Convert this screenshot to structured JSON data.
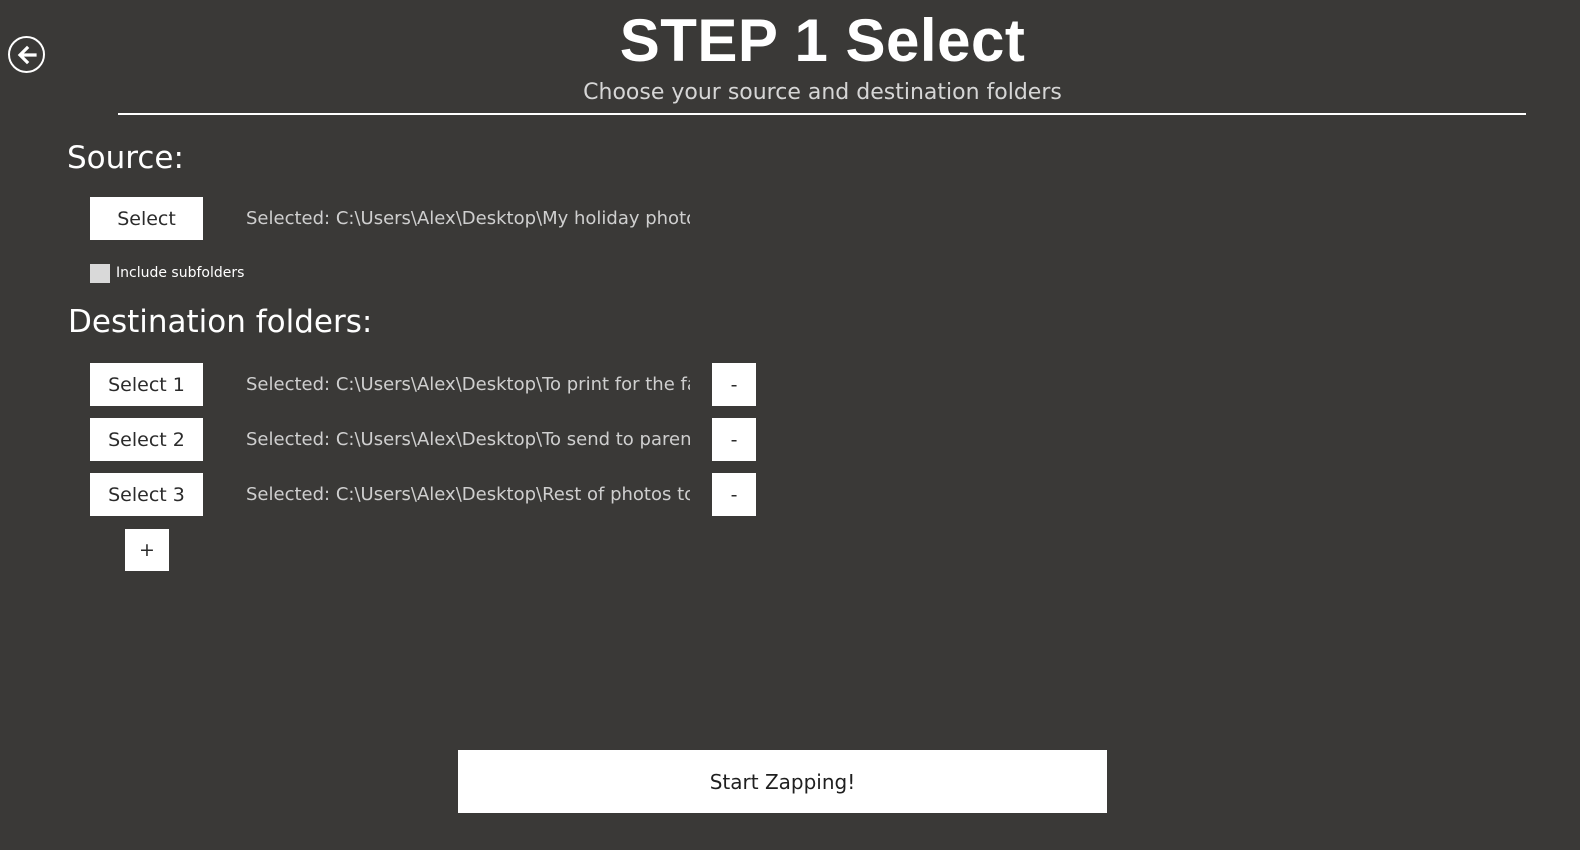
{
  "header": {
    "title": "STEP 1 Select",
    "subtitle": "Choose your source and destination folders"
  },
  "source": {
    "heading": "Source:",
    "select_label": "Select",
    "selected_text": "Selected: C:\\Users\\Alex\\Desktop\\My holiday photos",
    "include_subfolders_label": "Include subfolders",
    "include_subfolders_checked": false
  },
  "destinations": {
    "heading": "Destination folders:",
    "items": [
      {
        "select_label": "Select 1",
        "selected_text": "Selected: C:\\Users\\Alex\\Desktop\\To print for the family",
        "remove_label": "-"
      },
      {
        "select_label": "Select 2",
        "selected_text": "Selected: C:\\Users\\Alex\\Desktop\\To send to parents",
        "remove_label": "-"
      },
      {
        "select_label": "Select 3",
        "selected_text": "Selected: C:\\Users\\Alex\\Desktop\\Rest of photos to keep",
        "remove_label": "-"
      }
    ],
    "add_label": "+"
  },
  "start_label": "Start Zapping!",
  "colors": {
    "background": "#3a3937",
    "button_bg": "#ffffff",
    "button_text": "#2b2b2b",
    "secondary_text": "#cfcfcf"
  },
  "icons": {
    "back": "back-arrow-circle-icon"
  }
}
